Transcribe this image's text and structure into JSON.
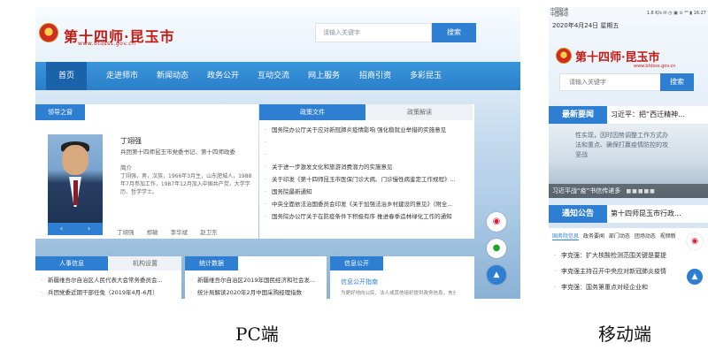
{
  "pc": {
    "site_title": "第十四师·昆玉市",
    "site_url": "www.btdsss.gov.cn",
    "search_placeholder": "请输入关键字",
    "search_button": "搜索",
    "nav": [
      "首页",
      "走进师市",
      "新闻动态",
      "政务公开",
      "互动交流",
      "网上服务",
      "招商引资",
      "多彩昆玉"
    ],
    "leader": {
      "tab": "领导之窗",
      "name": "丁翊强",
      "role": "兵团第十四师昆玉市党委书记、第十四师政委",
      "intro_label": "简介",
      "bio": "丁翊强，男，汉族，1966年3月生，山东肥城人，1988年7月参加工作，1987年12月加入中国共产党，大学学历、哲学学士。",
      "prev": "‹",
      "next": "›",
      "names": [
        "丁翊强",
        "郑敏",
        "李华斌",
        "赵卫东"
      ]
    },
    "policy": {
      "tab_active": "政策文件",
      "tab_other": "政策解读",
      "items": [
        "国务院办公厅关于应对新冠肺炎疫情影响 强化稳就业举措的实施意见",
        "",
        "",
        "关于进一步激发文化和旅游消费潜力的实施意见",
        "关于印发《第十四师昆玉市医保门诊大病、门诊慢性病鉴定工作规程》...",
        "国务院最新通知",
        "中央全面依法治国委员会印发《关于加强法治乡村建设的意见》（附全...",
        "国务院办公厅关于在防疫条件下积极有序 推进春季造林绿化工作的通知"
      ]
    },
    "personnel": {
      "tab_active": "人事信息",
      "tab_other": "机构设置",
      "items": [
        "新疆维吾尔自治区人民代表大会常务委员会...",
        "兵团党委近期干部任免（2019年4月-6月）"
      ]
    },
    "stats": {
      "tab": "统计数据",
      "items": [
        "新疆维吾尔自治区2019年国民经济和社会发...",
        "统计局解读2020年2月中国采购经理指数"
      ]
    },
    "info": {
      "tab": "信息公开",
      "title": "信息公开指南",
      "desc": "为更好地向公民、法人或其他组织提供政务信息，充分发挥政府信息对人民群众生产、生活和经济社会活动的服务作用"
    },
    "floats": {
      "weibo": "◉",
      "wechat": "●",
      "top": "▲"
    }
  },
  "mobile": {
    "status_left": "中国联通\n中国移动",
    "status_right": "1.8 K/s  ✉ ◷ ▣ ⊙ ⁴ᴳ  ▮ 16:27",
    "date": "2020年4月24日 星期五",
    "site_title": "第十四师·昆玉市",
    "site_url": "www.btdsss.gov.cn",
    "search_placeholder": "请输入关键字",
    "search_button": "搜索",
    "hot_tag": "最新要闻",
    "hot_text": "习近平：把“西迁精神...",
    "slide_text": "性实现，因时因势调整工作方式办法和重点、确保打赢疫情防控的攻坚战",
    "slide_caption": "习近平战“疫”书信传递多",
    "slide_dots": "■■■■■",
    "notice_tag": "通知公告",
    "notice_text": "第十四师昆玉市行政...",
    "tabs": [
      "国务院信息",
      "政务要闻",
      "部门动态",
      "团场动态",
      "视频新"
    ],
    "items": [
      "李克强：扩大核酸检测范围关键是要提",
      "李克强主持召开中央应对新冠肺炎疫情",
      "李克强：国务第重点对经企业和"
    ],
    "floats": {
      "weibo": "◉",
      "top": "▲"
    }
  },
  "captions": {
    "pc": "PC端",
    "mobile": "移动端"
  }
}
